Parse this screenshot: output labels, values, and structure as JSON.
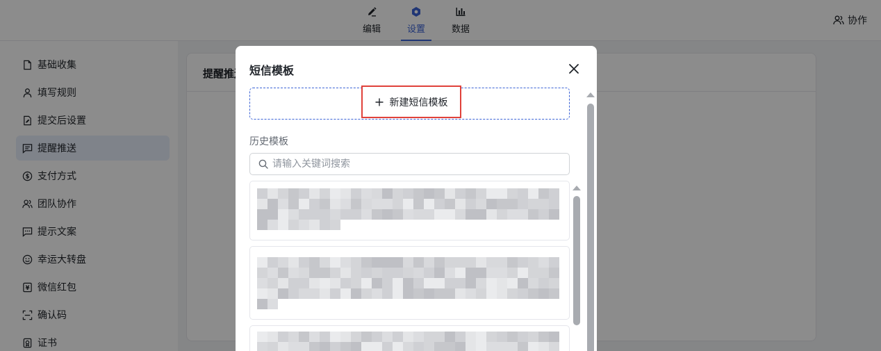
{
  "top_tabs": [
    {
      "label": "编辑",
      "icon": "pen-icon"
    },
    {
      "label": "设置",
      "icon": "hexagon-settings-icon",
      "active": true
    },
    {
      "label": "数据",
      "icon": "bar-chart-icon"
    }
  ],
  "collab_label": "协作",
  "sidebar": {
    "items": [
      {
        "label": "基础收集",
        "icon": "file-icon"
      },
      {
        "label": "填写规则",
        "icon": "user-icon"
      },
      {
        "label": "提交后设置",
        "icon": "file-edit-icon"
      },
      {
        "label": "提醒推送",
        "icon": "message-icon",
        "active": true
      },
      {
        "label": "支付方式",
        "icon": "dollar-circle-icon"
      },
      {
        "label": "团队协作",
        "icon": "users-icon"
      },
      {
        "label": "提示文案",
        "icon": "chat-dots-icon"
      },
      {
        "label": "幸运大转盘",
        "icon": "smile-icon"
      },
      {
        "label": "微信红包",
        "icon": "yen-icon"
      },
      {
        "label": "确认码",
        "icon": "scan-icon"
      },
      {
        "label": "证书",
        "icon": "certificate-icon"
      }
    ]
  },
  "card": {
    "title": "提醒推送"
  },
  "modal": {
    "title": "短信模板",
    "new_template_label": "新建短信模板",
    "history_label": "历史模板",
    "search_placeholder": "请输入关键词搜索"
  },
  "colors": {
    "accent": "#3b63d6",
    "highlight_border": "#e0413a"
  }
}
